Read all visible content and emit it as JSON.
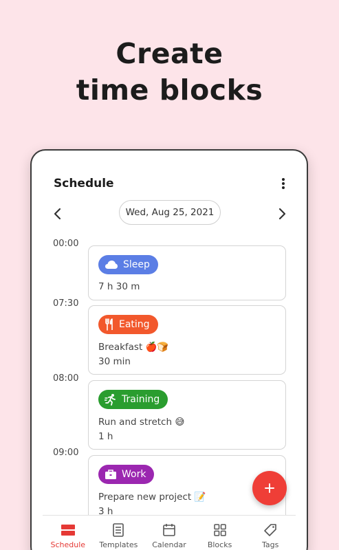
{
  "promo": {
    "line1": "Create",
    "line2": "time blocks"
  },
  "app": {
    "title": "Schedule",
    "date": "Wed, Aug 25, 2021"
  },
  "times": [
    "00:00",
    "07:30",
    "08:00",
    "09:00"
  ],
  "blocks": [
    {
      "tag": "Sleep",
      "description": "",
      "duration": "7 h 30 m",
      "color": "#5b7ee5",
      "icon": "cloud-icon"
    },
    {
      "tag": "Eating",
      "description": "Breakfast 🍎🍞",
      "duration": "30 min",
      "color": "#f2582c",
      "icon": "fork-knife-icon"
    },
    {
      "tag": "Training",
      "description": "Run and stretch 😅",
      "duration": "1 h",
      "color": "#2a9d2f",
      "icon": "runner-icon"
    },
    {
      "tag": "Work",
      "description": "Prepare new project 📝",
      "duration": "3 h",
      "color": "#9b27b0",
      "icon": "briefcase-icon"
    }
  ],
  "bottom_nav": [
    {
      "label": "Schedule",
      "icon": "schedule-icon",
      "active": true
    },
    {
      "label": "Templates",
      "icon": "templates-icon",
      "active": false
    },
    {
      "label": "Calendar",
      "icon": "calendar-icon",
      "active": false
    },
    {
      "label": "Blocks",
      "icon": "blocks-icon",
      "active": false
    },
    {
      "label": "Tags",
      "icon": "tag-icon",
      "active": false
    }
  ],
  "colors": {
    "accent": "#ef3e37",
    "background": "#fde4e9"
  }
}
